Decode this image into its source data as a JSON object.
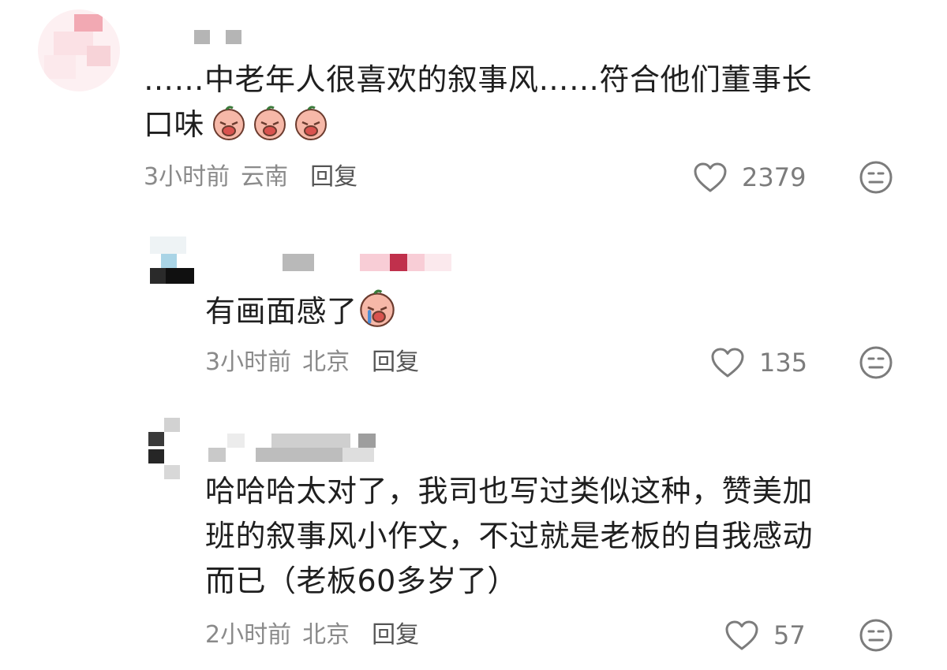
{
  "comments": [
    {
      "text_line1": "……中老年人很喜欢的叙事风……符合他们董事长",
      "text_line2": "口味",
      "emoji_icon": "crying-face-emoji",
      "emoji_count": 3,
      "time": "3小时前",
      "location": "云南",
      "reply_label": "回复",
      "likes": "2379"
    },
    {
      "text_line1": "有画面感了",
      "emoji_icon": "crying-face-emoji",
      "time": "3小时前",
      "location": "北京",
      "reply_label": "回复",
      "likes": "135"
    },
    {
      "text_line1": "哈哈哈太对了，我司也写过类似这种，赞美加",
      "text_line2": "班的叙事风小作文，不过就是老板的自我感动",
      "text_line3": "而已（老板60多岁了）",
      "time": "2小时前",
      "location": "北京",
      "reply_label": "回复",
      "likes": "57"
    }
  ],
  "icons": {
    "like": "heart-outline-icon",
    "dislike": "neutral-face-icon"
  },
  "colors": {
    "text": "#1f1f1f",
    "meta": "#8a8a8a",
    "icon": "#7c7c7c"
  }
}
